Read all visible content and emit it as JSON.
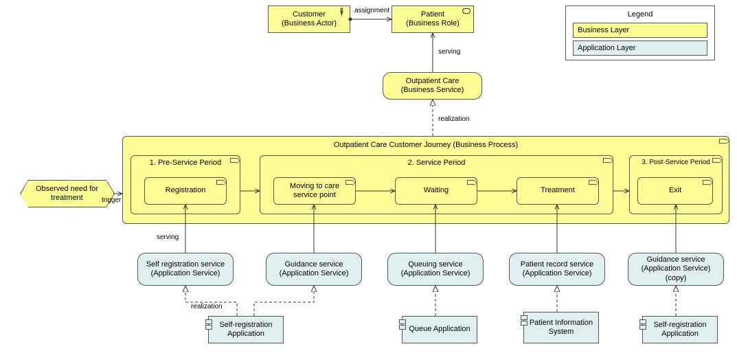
{
  "actors": {
    "customer": "Customer\n(Business Actor)",
    "patient": "Patient\n(Business Role)"
  },
  "services": {
    "outpatient_care": "Outpatient Care\n(Business Service)"
  },
  "journey": {
    "title": "Outpatient Care Customer Journey (Business Process)",
    "pre": {
      "title": "1. Pre-Service Period",
      "registration": "Registration"
    },
    "svc": {
      "title": "2. Service Period",
      "moving": "Moving to care service point",
      "waiting": "Waiting",
      "treatment": "Treatment"
    },
    "post": {
      "title": "3. Post-Service Period",
      "exit": "Exit"
    }
  },
  "event": {
    "need": "Observed need for treatment"
  },
  "app_services": {
    "selfreg": "Self registration service (Application Service)",
    "guidance": "Guidance service (Application Service)",
    "queuing": "Queuing service (Application Service)",
    "patientrec": "Patient record service (Application Service)",
    "guidance_copy": "Guidance service (Application Service) (copy)"
  },
  "apps": {
    "selfreg_app": "Self-registration Application",
    "queue_app": "Queue Application",
    "pis": "Patient Information System",
    "selfreg_app2": "Self-registration Application"
  },
  "edges": {
    "assignment": "assignment",
    "serving": "serving",
    "realization": "realization",
    "trigger": "trigger"
  },
  "legend": {
    "title": "Legend",
    "business": "Business Layer",
    "application": "Application Layer"
  }
}
